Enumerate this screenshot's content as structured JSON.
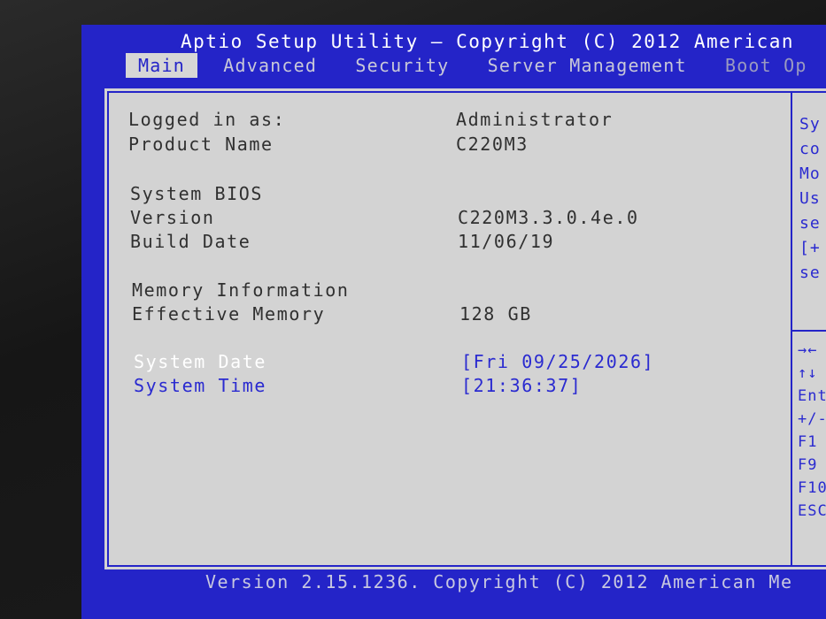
{
  "title": "Aptio Setup Utility – Copyright (C) 2012 American",
  "tabs": [
    "Main",
    "Advanced",
    "Security",
    "Server Management",
    "Boot Op"
  ],
  "rows": {
    "logged_in": {
      "label": "Logged in as:",
      "value": "Administrator"
    },
    "product_name": {
      "label": "Product Name",
      "value": "C220M3"
    },
    "system_bios": {
      "label": "System BIOS"
    },
    "version": {
      "label": "Version",
      "value": "C220M3.3.0.4e.0"
    },
    "build_date": {
      "label": "Build Date",
      "value": "11/06/19"
    },
    "memory_info": {
      "label": "Memory Information"
    },
    "effective_memory": {
      "label": "Effective Memory",
      "value": "128 GB"
    },
    "system_date": {
      "label": "System Date",
      "value": "[Fri 09/25/2026]"
    },
    "system_time": {
      "label": "System Time",
      "value": "[21:36:37]"
    }
  },
  "help_text": [
    "Sy",
    "co",
    "Mo",
    "Us",
    "se",
    "[+",
    "se"
  ],
  "key_hints": [
    "→←",
    "↑↓",
    "Ent",
    "+/-",
    "F1",
    "F9",
    "F10",
    "ESC"
  ],
  "footer": "Version 2.15.1236. Copyright (C) 2012 American Me"
}
